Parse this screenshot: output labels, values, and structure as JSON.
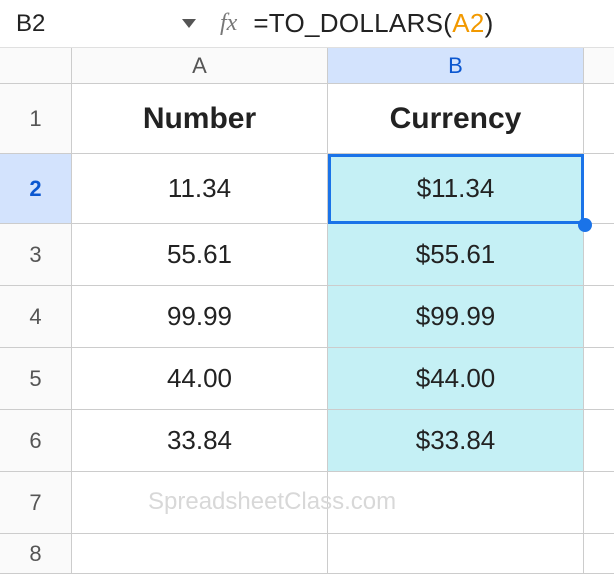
{
  "nameBox": {
    "ref": "B2"
  },
  "formulaBar": {
    "fxLabel": "fx",
    "prefix": "=TO_DOLLARS(",
    "ref": "A2",
    "suffix": ")"
  },
  "columns": {
    "a": "A",
    "b": "B"
  },
  "rowHeaders": {
    "r1": "1",
    "r2": "2",
    "r3": "3",
    "r4": "4",
    "r5": "5",
    "r6": "6",
    "r7": "7",
    "r8": "8"
  },
  "headers": {
    "a": "Number",
    "b": "Currency"
  },
  "rows": {
    "r2": {
      "a": "11.34",
      "b": "$11.34"
    },
    "r3": {
      "a": "55.61",
      "b": "$55.61"
    },
    "r4": {
      "a": "99.99",
      "b": "$99.99"
    },
    "r5": {
      "a": "44.00",
      "b": "$44.00"
    },
    "r6": {
      "a": "33.84",
      "b": "$33.84"
    }
  },
  "watermark": "SpreadsheetClass.com",
  "chart_data": {
    "type": "table",
    "columns": [
      "Number",
      "Currency"
    ],
    "rows": [
      [
        "11.34",
        "$11.34"
      ],
      [
        "55.61",
        "$55.61"
      ],
      [
        "99.99",
        "$99.99"
      ],
      [
        "44.00",
        "$44.00"
      ],
      [
        "33.84",
        "$33.84"
      ]
    ]
  }
}
